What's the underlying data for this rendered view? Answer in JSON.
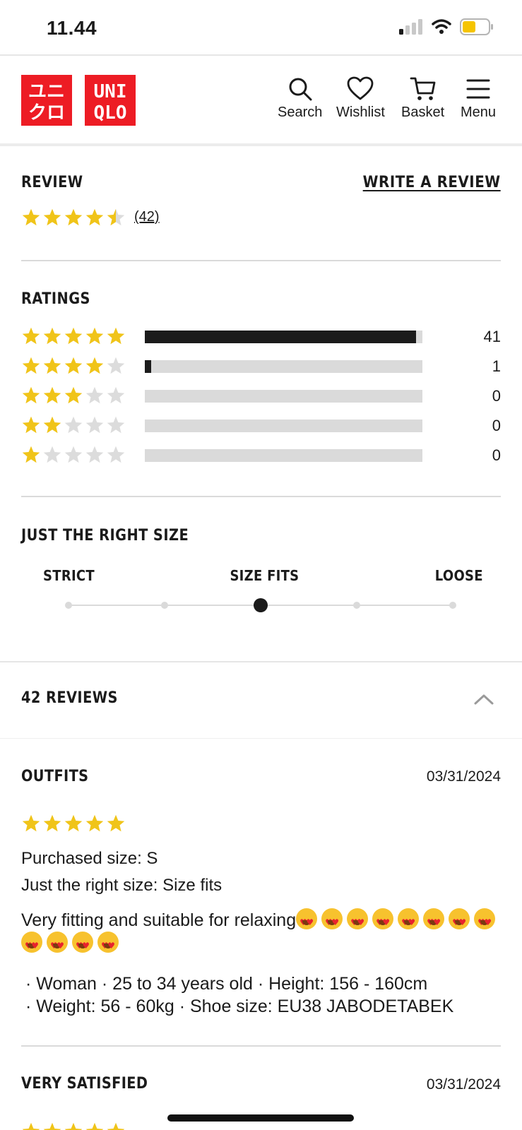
{
  "status_bar": {
    "time": "11.44",
    "icons": [
      "signal-icon",
      "wifi-icon",
      "battery-icon"
    ]
  },
  "brand": {
    "logo_katakana_top": "ユニ",
    "logo_katakana_bottom": "クロ",
    "logo_latin_top": "UNI",
    "logo_latin_bottom": "QLO",
    "color": "#ed1c24"
  },
  "nav": [
    {
      "label": "Search",
      "icon": "search-icon"
    },
    {
      "label": "Wishlist",
      "icon": "heart-icon"
    },
    {
      "label": "Basket",
      "icon": "cart-icon"
    },
    {
      "label": "Menu",
      "icon": "menu-icon"
    }
  ],
  "review": {
    "title": "REVIEW",
    "write_label": "WRITE A REVIEW",
    "average_rating": 4.5,
    "count_label": "(42)"
  },
  "ratings": {
    "title": "RATINGS",
    "rows": [
      {
        "stars": 5,
        "count": "41",
        "fill_fraction": 0.976
      },
      {
        "stars": 4,
        "count": "1",
        "fill_fraction": 0.024
      },
      {
        "stars": 3,
        "count": "0",
        "fill_fraction": 0
      },
      {
        "stars": 2,
        "count": "0",
        "fill_fraction": 0
      },
      {
        "stars": 1,
        "count": "0",
        "fill_fraction": 0
      }
    ]
  },
  "fit": {
    "title": "JUST THE RIGHT SIZE",
    "strict_label": "STRICT",
    "fits_label": "SIZE FITS",
    "loose_label": "LOOSE",
    "steps": 5,
    "selected_step": 3
  },
  "reviews_list": {
    "header": "42 REVIEWS",
    "items": [
      {
        "title": "OUTFITS",
        "date": "03/31/2024",
        "stars": 5,
        "purchased": "Purchased size: S",
        "fit": "Just the right size: Size fits",
        "body": "Very fitting and suitable for relaxing",
        "emoji_count": 12,
        "profile_line1": "· Woman · 25 to 34 years old · Height: 156 - 160cm",
        "profile_line2": "· Weight: 56 - 60kg · Shoe size: EU38 JABODETABEK"
      },
      {
        "title": "VERY SATISFIED",
        "date": "03/31/2024",
        "stars": 5
      }
    ]
  },
  "colors": {
    "star": "#f0c419",
    "star_empty": "#dcdcdc",
    "text": "#1b1b1b"
  }
}
